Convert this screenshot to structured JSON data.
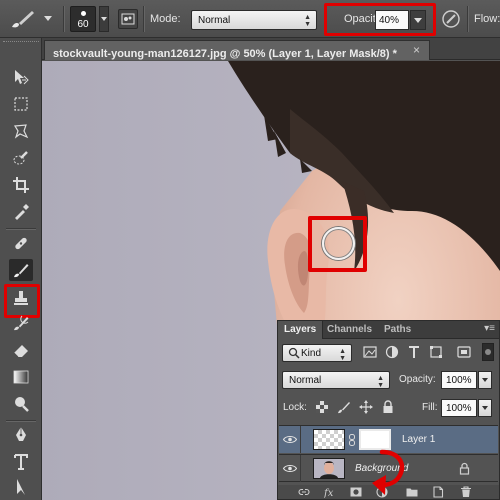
{
  "options_bar": {
    "brush_size": "60",
    "mode_label": "Mode:",
    "mode_value": "Normal",
    "opacity_label": "Opacity:",
    "opacity_value": "40%",
    "flow_label": "Flow:"
  },
  "document": {
    "tab_title": "stockvault-young-man126127.jpg @ 50% (Layer 1, Layer Mask/8) *",
    "close_glyph": "×"
  },
  "layers_panel": {
    "tabs": [
      "Layers",
      "Channels",
      "Paths"
    ],
    "kind_label": "Kind",
    "blend_mode": "Normal",
    "opacity_label": "Opacity:",
    "opacity_value": "100%",
    "lock_label": "Lock:",
    "fill_label": "Fill:",
    "fill_value": "100%",
    "layers": [
      {
        "name": "Layer 1",
        "selected": true,
        "has_mask": true
      },
      {
        "name": "Background",
        "selected": false,
        "locked": true
      }
    ]
  },
  "colors": {
    "highlight": "#e00000",
    "canvas_bg": "#b5b2bf",
    "selected_layer": "#5a6c84",
    "ui_dark": "#535353"
  },
  "icons": {
    "toolbar": [
      "move-icon",
      "marquee-icon",
      "lasso-icon",
      "quick-selection-icon",
      "crop-icon",
      "eyedropper-icon",
      "healing-brush-icon",
      "brush-icon",
      "clone-stamp-icon",
      "history-brush-icon",
      "eraser-icon",
      "gradient-icon",
      "dodge-icon",
      "pen-icon",
      "type-icon",
      "path-selection-icon"
    ],
    "footer": [
      "link-icon",
      "fx-icon",
      "add-mask-icon",
      "adjustment-icon",
      "group-icon",
      "new-layer-icon",
      "trash-icon"
    ]
  }
}
